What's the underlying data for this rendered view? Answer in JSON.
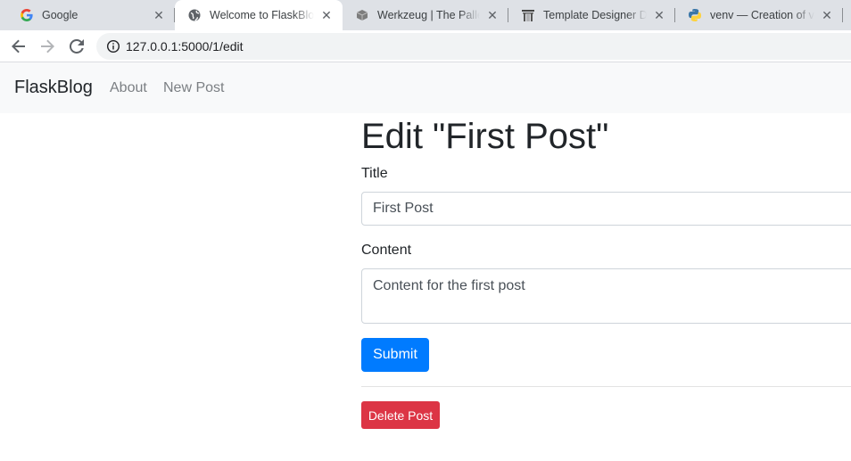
{
  "browser": {
    "tabs": [
      {
        "title": "Google",
        "icon": "google-icon",
        "active": false
      },
      {
        "title": "Welcome to FlaskBlog!",
        "icon": "globe-icon",
        "active": true
      },
      {
        "title": "Werkzeug | The Pallets Projects",
        "icon": "werkzeug-icon",
        "active": false
      },
      {
        "title": "Template Designer Documentation",
        "icon": "jinja-icon",
        "active": false
      },
      {
        "title": "venv — Creation of virtual environments",
        "icon": "python-icon",
        "active": false
      }
    ],
    "close_glyph": "✕",
    "url": "127.0.0.1:5000/1/edit"
  },
  "navbar": {
    "brand": "FlaskBlog",
    "links": [
      "About",
      "New Post"
    ]
  },
  "form": {
    "heading": "Edit \"First Post\"",
    "title_label": "Title",
    "title_value": "First Post",
    "content_label": "Content",
    "content_value": "Content for the first post",
    "submit_label": "Submit",
    "delete_label": "Delete Post"
  },
  "colors": {
    "primary": "#007bff",
    "danger": "#dc3545",
    "navbar_bg": "#f8f9fa"
  }
}
